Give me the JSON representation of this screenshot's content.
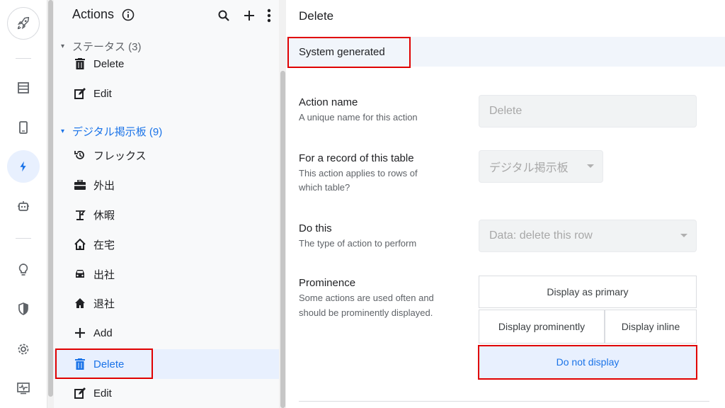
{
  "rail": {
    "items": [
      {
        "name": "rocket-icon"
      },
      {
        "name": "table-icon"
      },
      {
        "name": "phone-icon"
      },
      {
        "name": "lightning-icon",
        "active": true
      },
      {
        "name": "robot-icon"
      },
      {
        "name": "lightbulb-icon"
      },
      {
        "name": "shield-icon"
      },
      {
        "name": "gear-icon"
      },
      {
        "name": "monitor-pulse-icon"
      }
    ]
  },
  "list": {
    "title": "Actions",
    "groups": [
      {
        "label": "ステータス (3)",
        "color": "#5f6368"
      },
      {
        "label": "デジタル掲示板 (9)",
        "color": "#1a73e8"
      }
    ],
    "items": [
      {
        "label": "Delete",
        "icon": "trash-icon"
      },
      {
        "label": "Edit",
        "icon": "edit-icon"
      },
      {
        "label": "フレックス",
        "icon": "history-icon"
      },
      {
        "label": "外出",
        "icon": "briefcase-icon"
      },
      {
        "label": "休暇",
        "icon": "beach-icon"
      },
      {
        "label": "在宅",
        "icon": "house-icon"
      },
      {
        "label": "出社",
        "icon": "car-icon"
      },
      {
        "label": "退社",
        "icon": "home-icon"
      },
      {
        "label": "Add",
        "icon": "plus-icon"
      },
      {
        "label": "Delete",
        "icon": "trash-icon",
        "selected": true
      },
      {
        "label": "Edit",
        "icon": "edit-icon"
      }
    ]
  },
  "main": {
    "title": "Delete",
    "tab": "System generated",
    "fields": {
      "action_name": {
        "label": "Action name",
        "help": "A unique name for this action",
        "value": "Delete"
      },
      "table": {
        "label": "For a record of this table",
        "help1": "This action applies to rows of",
        "help2": "which table?",
        "value": "デジタル掲示板"
      },
      "do_this": {
        "label": "Do this",
        "help": "The type of action to perform",
        "value": "Data: delete this row"
      },
      "prominence": {
        "label": "Prominence",
        "help1": "Some actions are used often and",
        "help2": "should be prominently displayed.",
        "options": {
          "primary": "Display as primary",
          "prominently": "Display prominently",
          "inline": "Display inline",
          "none": "Do not display"
        },
        "selected": "Do not display"
      }
    }
  },
  "colors": {
    "accent": "#1a73e8",
    "highlight": "#e00000",
    "selected_bg": "#e8f0fe"
  }
}
